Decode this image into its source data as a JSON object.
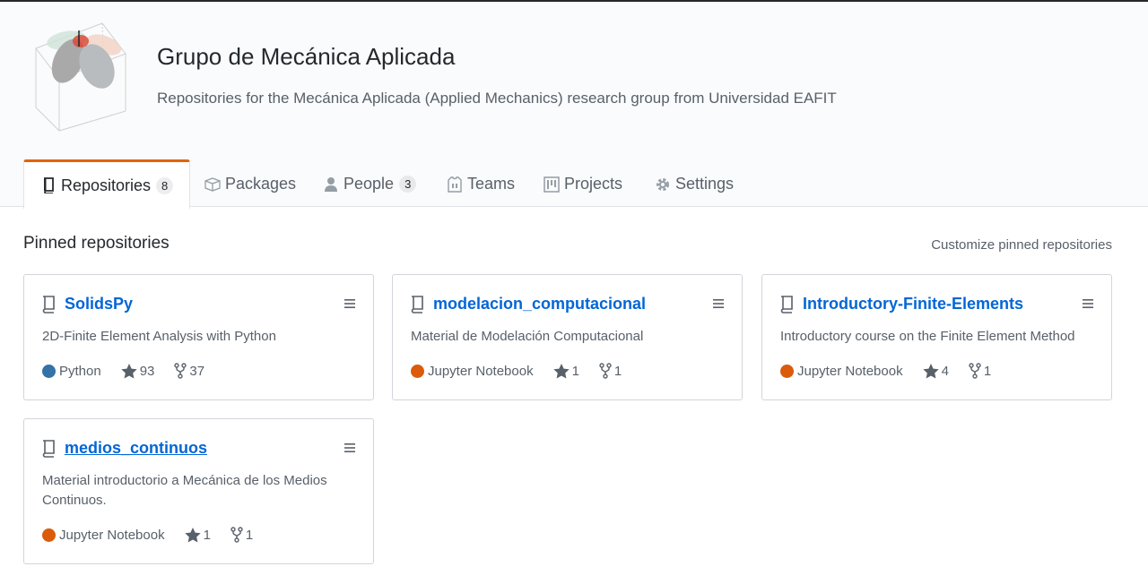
{
  "org": {
    "name": "Grupo de Mecánica Aplicada",
    "description": "Repositories for the Mecánica Aplicada (Applied Mechanics) research group from Universidad EAFIT"
  },
  "tabs": [
    {
      "label": "Repositories",
      "count": "8",
      "icon": "repo-icon",
      "selected": true
    },
    {
      "label": "Packages",
      "icon": "package-icon"
    },
    {
      "label": "People",
      "count": "3",
      "icon": "person-icon"
    },
    {
      "label": "Teams",
      "icon": "jersey-icon"
    },
    {
      "label": "Projects",
      "icon": "project-icon"
    },
    {
      "label": "Settings",
      "icon": "gear-icon"
    }
  ],
  "pinned": {
    "title": "Pinned repositories",
    "customize_label": "Customize pinned repositories",
    "repos": [
      {
        "name": "SolidsPy",
        "description": "2D-Finite Element Analysis with Python",
        "language": "Python",
        "language_color": "#3572A5",
        "stars": "93",
        "forks": "37"
      },
      {
        "name": "modelacion_computacional",
        "description": "Material de Modelación Computacional",
        "language": "Jupyter Notebook",
        "language_color": "#DA5B0B",
        "stars": "1",
        "forks": "1"
      },
      {
        "name": "Introductory-Finite-Elements",
        "description": "Introductory course on the Finite Element Method",
        "language": "Jupyter Notebook",
        "language_color": "#DA5B0B",
        "stars": "4",
        "forks": "1"
      },
      {
        "name": "medios_continuos",
        "description": "Material introductorio a Mecánica de los Medios Continuos.",
        "language": "Jupyter Notebook",
        "language_color": "#DA5B0B",
        "stars": "1",
        "forks": "1"
      }
    ]
  },
  "colors": {
    "accent_tab": "#e36209",
    "link": "#0366d6",
    "muted": "#586069"
  }
}
